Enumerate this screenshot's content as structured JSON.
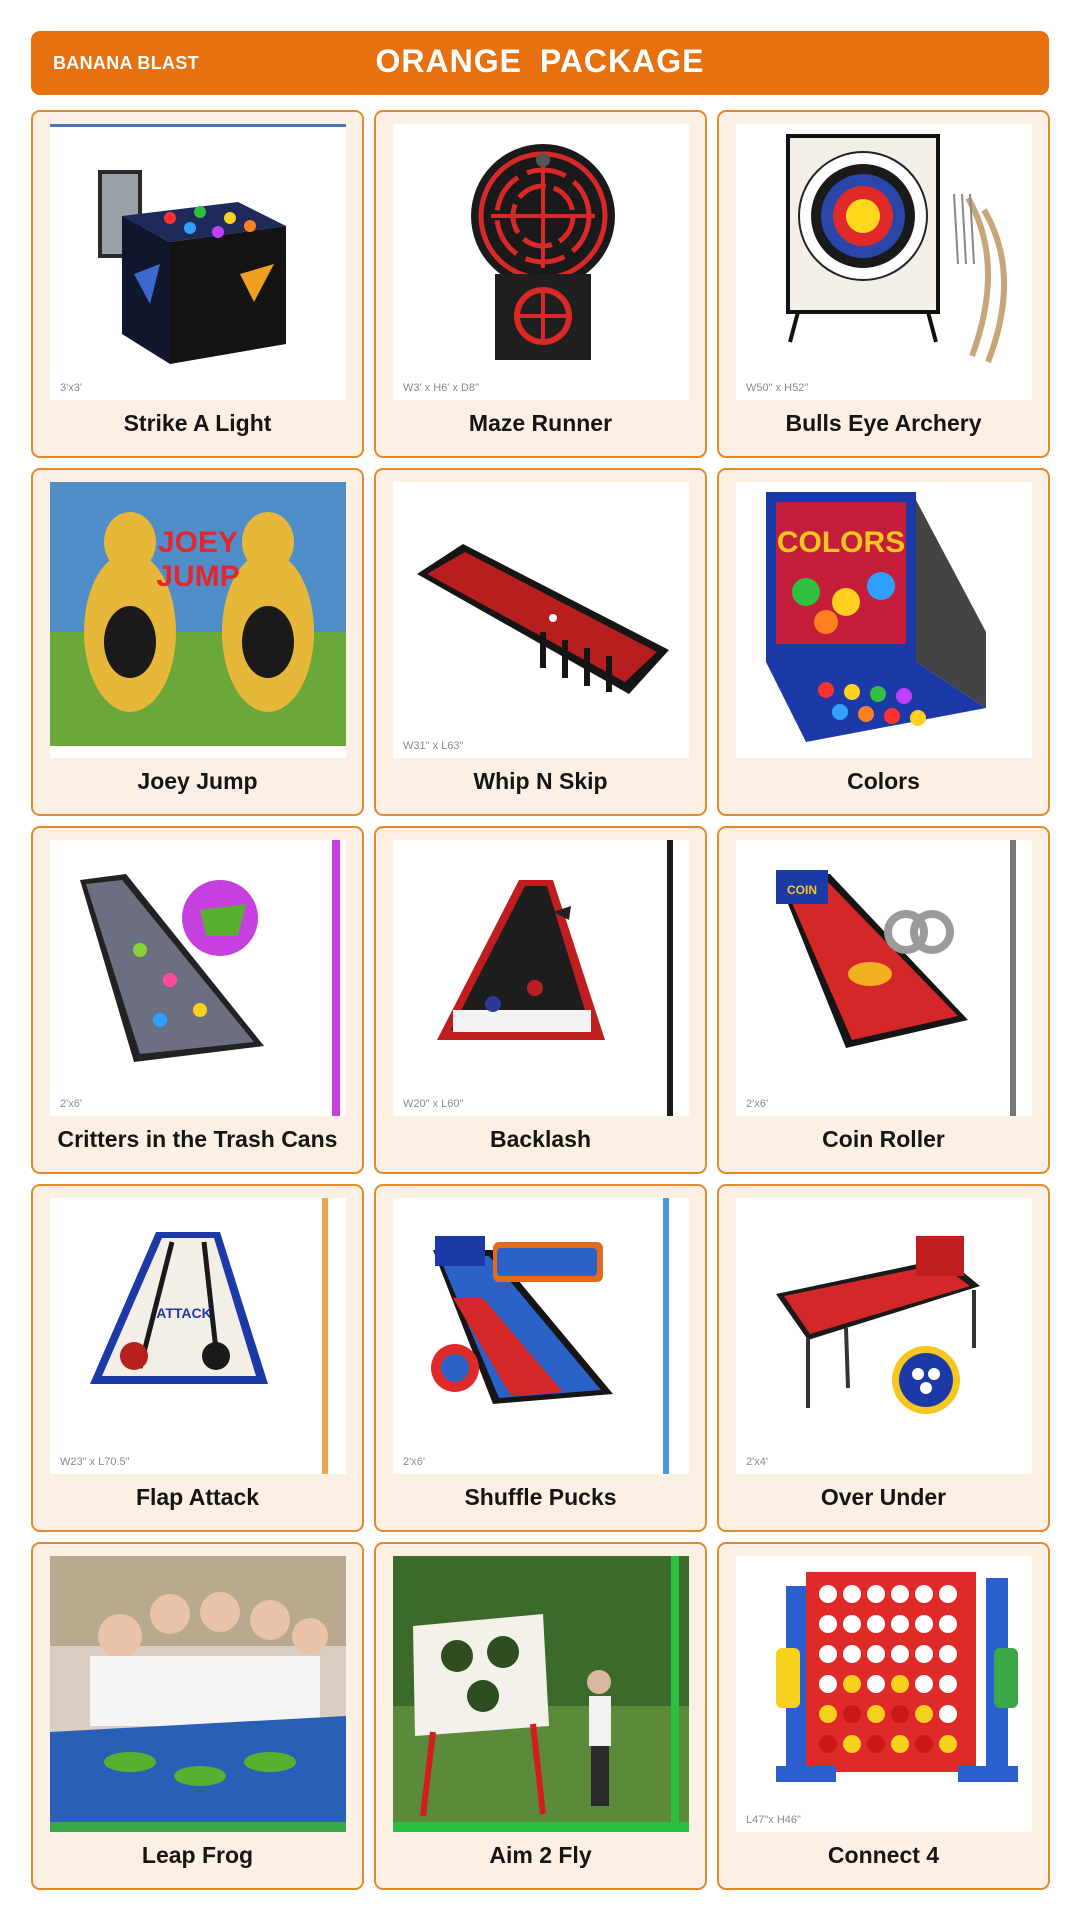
{
  "header": {
    "brand": "BANANA BLAST",
    "title": "ORANGE  PACKAGE"
  },
  "colors": {
    "header_orange": "#e7700f",
    "card_border": "#e28a2c",
    "card_background": "#fcf0e4"
  },
  "games": [
    {
      "name": "Strike A Light",
      "dimensions": "3'x3'",
      "image": "strike-a-light-table-image"
    },
    {
      "name": "Maze Runner",
      "dimensions": "W3' x H6' x D8\"",
      "image": "maze-runner-image"
    },
    {
      "name": "Bulls Eye Archery",
      "dimensions": "W50\" x H52\"",
      "image": "archery-target-image"
    },
    {
      "name": "Joey Jump",
      "dimensions": "",
      "image": "kangaroo-backdrop-image"
    },
    {
      "name": "Whip N Skip",
      "dimensions": "W31\" x L63\"",
      "image": "skee-table-image"
    },
    {
      "name": "Colors",
      "dimensions": "",
      "image": "colors-ball-game-image"
    },
    {
      "name": "Critters in the Trash Cans",
      "dimensions": "2'x6'",
      "image": "critters-lane-image"
    },
    {
      "name": "Backlash",
      "dimensions": "W20\" x L60\"",
      "image": "backlash-lane-image"
    },
    {
      "name": "Coin Roller",
      "dimensions": "2'x6'",
      "image": "coin-roller-lane-image"
    },
    {
      "name": "Flap Attack",
      "dimensions": "W23\" x L70.5\"",
      "image": "flap-attack-lane-image"
    },
    {
      "name": "Shuffle Pucks",
      "dimensions": "2'x6'",
      "image": "shuffle-pucks-lane-image"
    },
    {
      "name": "Over Under",
      "dimensions": "2'x4'",
      "image": "over-under-table-image"
    },
    {
      "name": "Leap Frog",
      "dimensions": "",
      "image": "leap-frog-photo"
    },
    {
      "name": "Aim 2 Fly",
      "dimensions": "",
      "image": "aim-2-fly-photo"
    },
    {
      "name": "Connect 4",
      "dimensions": "L47\"x H46\"",
      "image": "giant-connect-four-image"
    }
  ]
}
